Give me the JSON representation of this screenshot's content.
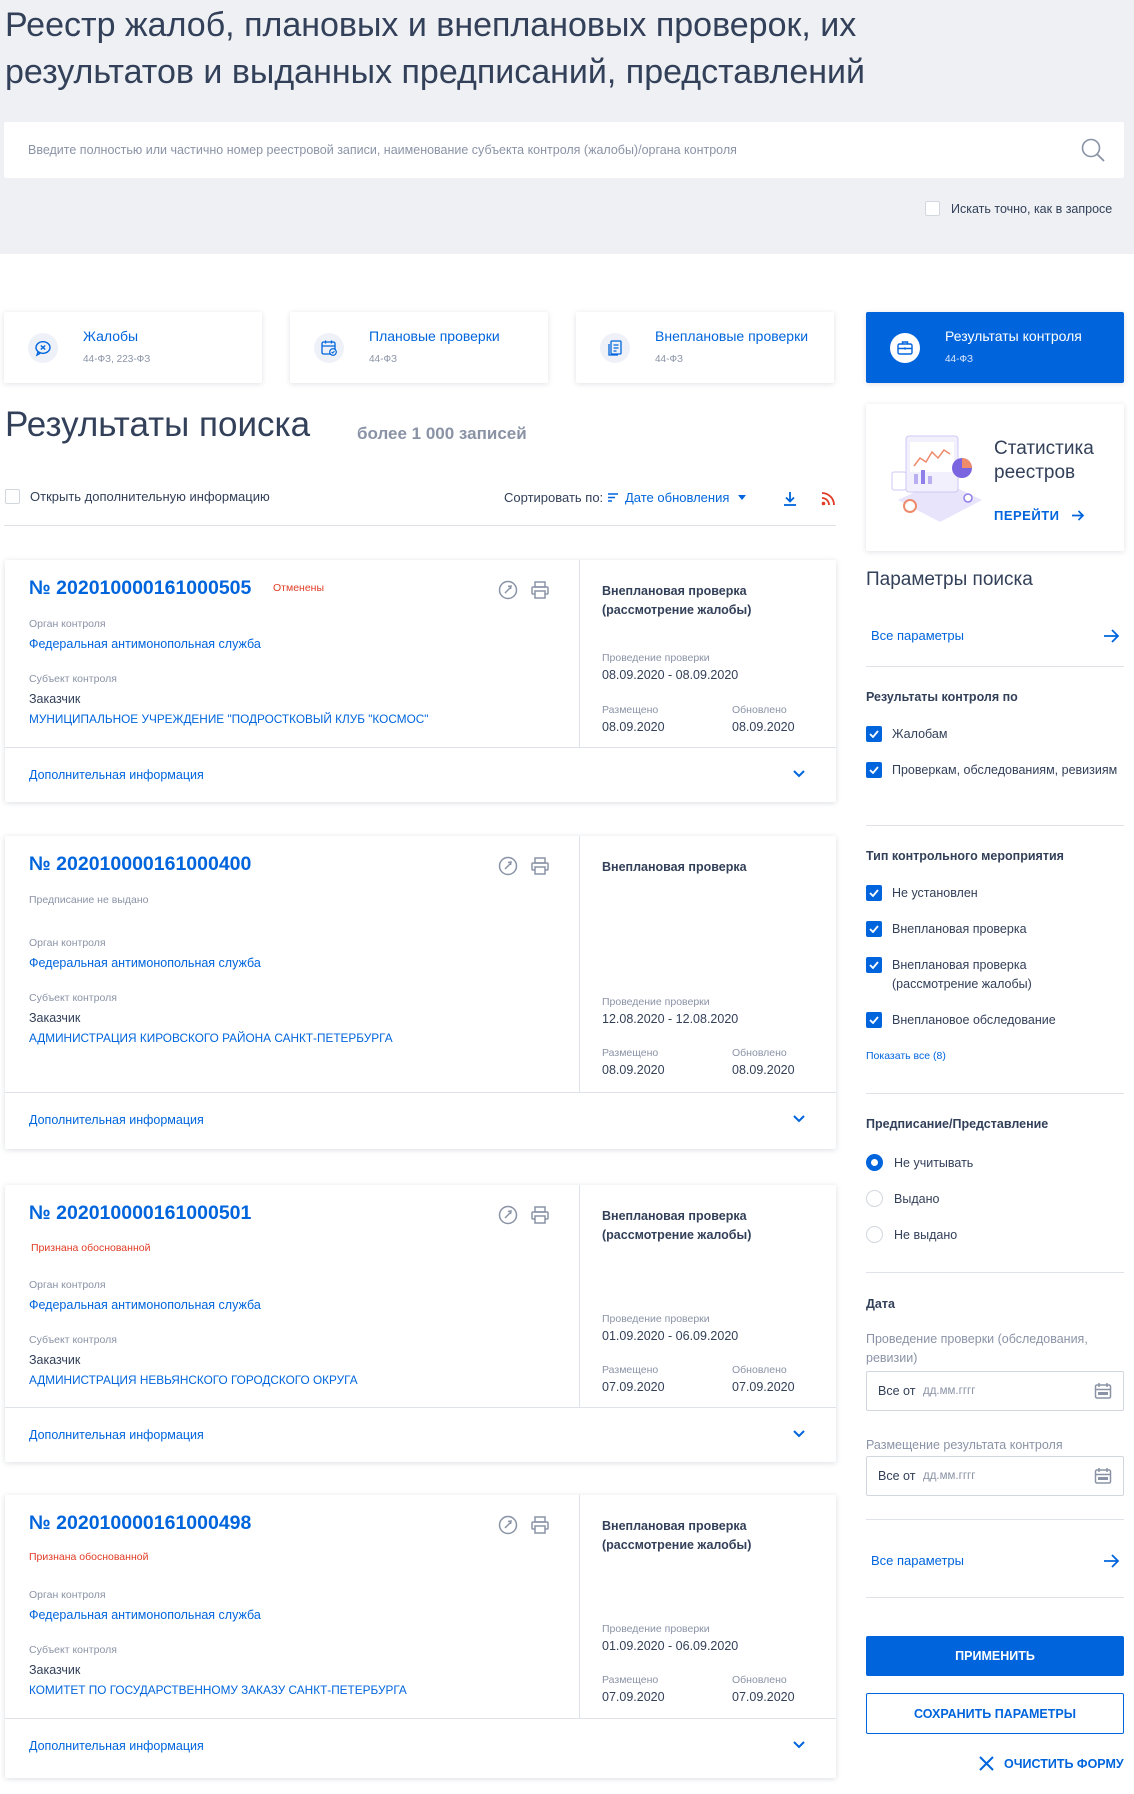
{
  "header": {
    "title": "Реестр жалоб, плановых и внеплановых проверок, их результатов и выданных предписаний, представлений"
  },
  "search": {
    "placeholder": "Введите полностью или частично номер реестровой записи, наименование субъекта контроля (жалобы)/органа контроля",
    "exact_label": "Искать точно, как в запросе"
  },
  "tiles": [
    {
      "title": "Жалобы",
      "sub": "44-ФЗ, 223-ФЗ",
      "icon": "complaint-icon"
    },
    {
      "title": "Плановые проверки",
      "sub": "44-ФЗ",
      "icon": "calendar-check-icon"
    },
    {
      "title": "Внеплановые проверки",
      "sub": "44-ФЗ",
      "icon": "document-stack-icon"
    },
    {
      "title": "Результаты контроля",
      "sub": "44-ФЗ",
      "icon": "briefcase-icon"
    }
  ],
  "results": {
    "title": "Результаты поиска",
    "count": "более 1 000 записей",
    "open_info": "Открыть дополнительную информацию",
    "sort_label": "Сортировать по:",
    "sort_value": "Дате обновления"
  },
  "labels": {
    "org": "Орган контроля",
    "subject": "Субъект контроля",
    "date_check": "Проведение проверки",
    "placed": "Размещено",
    "updated": "Обновлено",
    "more": "Дополнительная информация"
  },
  "cards": [
    {
      "number": "№ 202010000161000505",
      "status": "Отменены",
      "org": "Федеральная антимонопольная служба",
      "subject_type": "Заказчик",
      "subject": "МУНИЦИПАЛЬНОЕ УЧРЕЖДЕНИЕ \"ПОДРОСТКОВЫЙ КЛУБ \"КОСМОС\"",
      "type": "Внеплановая проверка (рассмотрение жалобы)",
      "period": "08.09.2020 - 08.09.2020",
      "placed": "08.09.2020",
      "updated": "08.09.2020"
    },
    {
      "number": "№ 202010000161000400",
      "status": "Предписание не выдано",
      "org": "Федеральная антимонопольная служба",
      "subject_type": "Заказчик",
      "subject": "АДМИНИСТРАЦИЯ КИРОВСКОГО РАЙОНА САНКТ-ПЕТЕРБУРГА",
      "type": "Внеплановая проверка",
      "period": "12.08.2020 - 12.08.2020",
      "placed": "08.09.2020",
      "updated": "08.09.2020"
    },
    {
      "number": "№ 202010000161000501",
      "status": "Признана обоснованной",
      "org": "Федеральная антимонопольная служба",
      "subject_type": "Заказчик",
      "subject": "АДМИНИСТРАЦИЯ НЕВЬЯНСКОГО ГОРОДСКОГО ОКРУГА",
      "type": "Внеплановая проверка (рассмотрение жалобы)",
      "period": "01.09.2020 - 06.09.2020",
      "placed": "07.09.2020",
      "updated": "07.09.2020"
    },
    {
      "number": "№ 202010000161000498",
      "status": "Признана обоснованной",
      "org": "Федеральная антимонопольная служба",
      "subject_type": "Заказчик",
      "subject": "КОМИТЕТ ПО ГОСУДАРСТВЕННОМУ ЗАКАЗУ САНКТ-ПЕТЕРБУРГА",
      "type": "Внеплановая проверка (рассмотрение жалобы)",
      "period": "01.09.2020 - 06.09.2020",
      "placed": "07.09.2020",
      "updated": "07.09.2020"
    }
  ],
  "stat": {
    "title": "Статистика реестров",
    "link": "ПЕРЕЙТИ"
  },
  "params": {
    "title": "Параметры поиска",
    "all": "Все параметры",
    "results_by": {
      "title": "Результаты контроля по",
      "items": [
        "Жалобам",
        "Проверкам, обследованиям, ревизиям"
      ]
    },
    "event_type": {
      "title": "Тип контрольного мероприятия",
      "items": [
        "Не установлен",
        "Внеплановая проверка",
        "Внеплановая проверка (рассмотрение жалобы)",
        "Внеплановое обследование"
      ],
      "show_all": "Показать все (8)"
    },
    "prescription": {
      "title": "Предписание/Представление",
      "options": [
        "Не учитывать",
        "Выдано",
        "Не выдано"
      ],
      "selected": "Не учитывать"
    },
    "date": {
      "title": "Дата",
      "check_label": "Проведение проверки (обследования, ревизии)",
      "place_label": "Размещение результата контроля",
      "from": "Все от",
      "placeholder": "дд.мм.гггг"
    },
    "apply": "ПРИМЕНИТЬ",
    "save": "СОХРАНИТЬ ПАРАМЕТРЫ",
    "clear": "ОЧИСТИТЬ ФОРМУ"
  },
  "colors": {
    "accent": "#0065dd",
    "text": "#334059",
    "muted": "#8a93a6",
    "status_red": "#e03b25",
    "bg": "#eef0f3"
  }
}
